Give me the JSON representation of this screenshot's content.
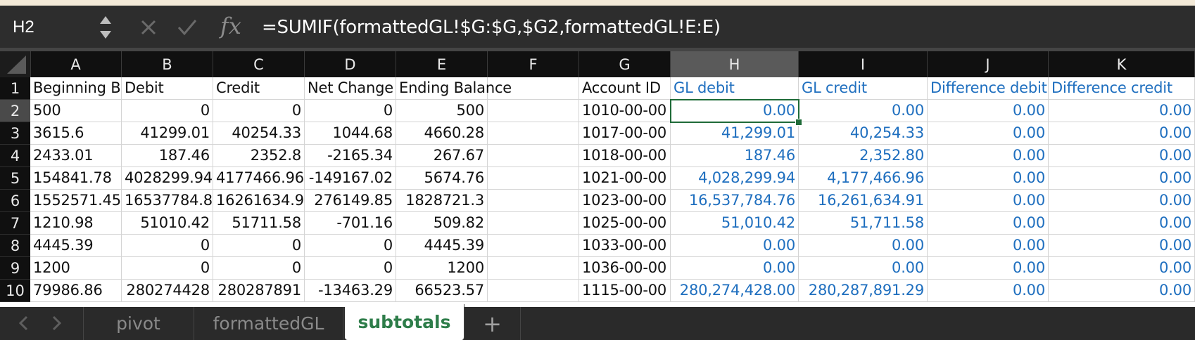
{
  "formula_bar": {
    "name_box": "H2",
    "fx_label": "fx",
    "formula": "=SUMIF(formattedGL!$G:$G,$G2,formattedGL!E:E)"
  },
  "columns": [
    "A",
    "B",
    "C",
    "D",
    "E",
    "F",
    "G",
    "H",
    "I",
    "J",
    "K"
  ],
  "selected_cell": {
    "column": "H",
    "row": 2
  },
  "rows": [
    {
      "n": "1",
      "cells": [
        "Beginning Ba",
        "Debit",
        "Credit",
        "Net Change",
        "Ending Balance",
        "",
        "Account ID",
        "GL debit",
        "GL credit",
        "Difference debit",
        "Difference credit"
      ]
    },
    {
      "n": "2",
      "cells": [
        "500",
        "0",
        "0",
        "0",
        "500",
        "",
        "1010-00-00",
        "0.00",
        "0.00",
        "0.00",
        "0.00"
      ]
    },
    {
      "n": "3",
      "cells": [
        "3615.6",
        "41299.01",
        "40254.33",
        "1044.68",
        "4660.28",
        "",
        "1017-00-00",
        "41,299.01",
        "40,254.33",
        "0.00",
        "0.00"
      ]
    },
    {
      "n": "4",
      "cells": [
        "2433.01",
        "187.46",
        "2352.8",
        "-2165.34",
        "267.67",
        "",
        "1018-00-00",
        "187.46",
        "2,352.80",
        "0.00",
        "0.00"
      ]
    },
    {
      "n": "5",
      "cells": [
        "154841.78",
        "4028299.94",
        "4177466.96",
        "-149167.02",
        "5674.76",
        "",
        "1021-00-00",
        "4,028,299.94",
        "4,177,466.96",
        "0.00",
        "0.00"
      ]
    },
    {
      "n": "6",
      "cells": [
        "1552571.45",
        "16537784.8",
        "16261634.9",
        "276149.85",
        "1828721.3",
        "",
        "1023-00-00",
        "16,537,784.76",
        "16,261,634.91",
        "0.00",
        "0.00"
      ]
    },
    {
      "n": "7",
      "cells": [
        "1210.98",
        "51010.42",
        "51711.58",
        "-701.16",
        "509.82",
        "",
        "1025-00-00",
        "51,010.42",
        "51,711.58",
        "0.00",
        "0.00"
      ]
    },
    {
      "n": "8",
      "cells": [
        "4445.39",
        "0",
        "0",
        "0",
        "4445.39",
        "",
        "1033-00-00",
        "0.00",
        "0.00",
        "0.00",
        "0.00"
      ]
    },
    {
      "n": "9",
      "cells": [
        "1200",
        "0",
        "0",
        "0",
        "1200",
        "",
        "1036-00-00",
        "0.00",
        "0.00",
        "0.00",
        "0.00"
      ]
    },
    {
      "n": "10",
      "cells": [
        "79986.86",
        "280274428",
        "280287891",
        "-13463.29",
        "66523.57",
        "",
        "1115-00-00",
        "280,274,428.00",
        "280,287,891.29",
        "0.00",
        "0.00"
      ]
    }
  ],
  "sheet_tabs": {
    "tabs": [
      "pivot",
      "formattedGL",
      "subtotals"
    ],
    "active": "subtotals",
    "add_label": "+"
  },
  "colors": {
    "selection": "#1f6b38",
    "link_blue": "#1f6fbf",
    "active_tab_text": "#2e7d4a"
  }
}
